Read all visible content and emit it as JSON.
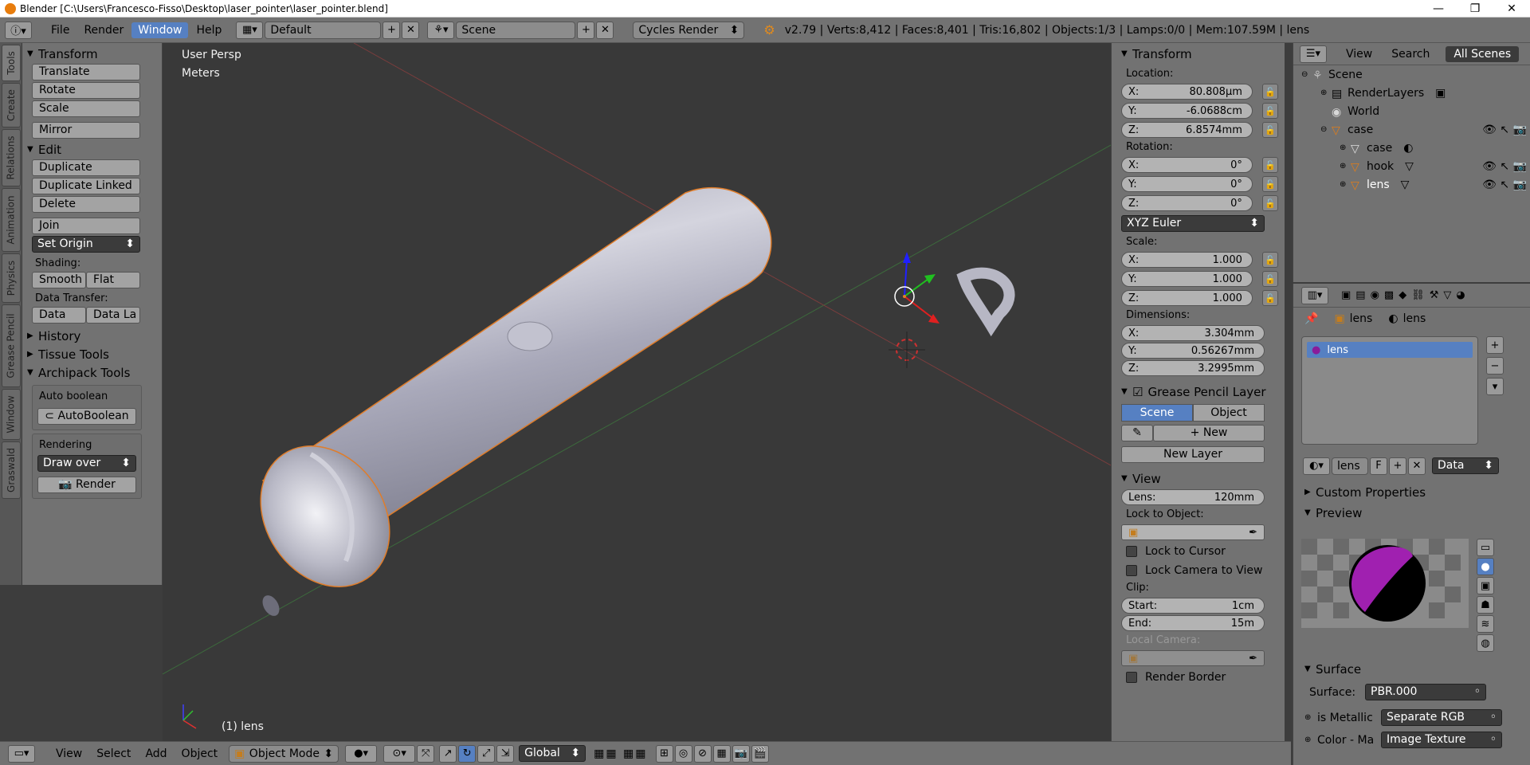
{
  "titlebar": {
    "title": "Blender [C:\\Users\\Francesco-Fisso\\Desktop\\laser_pointer\\laser_pointer.blend]",
    "minimize": "—",
    "maximize": "❐",
    "close": "✕"
  },
  "header": {
    "menus": [
      "File",
      "Render",
      "Window",
      "Help"
    ],
    "active_menu": "Window",
    "layout": "Default",
    "scene": "Scene",
    "engine": "Cycles Render",
    "stats": "v2.79 | Verts:8,412 | Faces:8,401 | Tris:16,802 | Objects:1/3 | Lamps:0/0 | Mem:107.59M | lens"
  },
  "vtabs": [
    "Tools",
    "Create",
    "Relations",
    "Animation",
    "Physics",
    "Grease Pencil",
    "Window",
    "Graswald"
  ],
  "toolshelf": {
    "transform": {
      "title": "Transform",
      "buttons": [
        "Translate",
        "Rotate",
        "Scale",
        "Mirror"
      ]
    },
    "edit": {
      "title": "Edit",
      "buttons": [
        "Duplicate",
        "Duplicate Linked",
        "Delete",
        "Join"
      ],
      "set_origin": "Set Origin",
      "shading_label": "Shading:",
      "smooth": "Smooth",
      "flat": "Flat",
      "data_transfer_label": "Data Transfer:",
      "data": "Data",
      "data_la": "Data La"
    },
    "history": "History",
    "tissue_tools": "Tissue Tools",
    "archipack": "Archipack Tools",
    "auto_boolean_label": "Auto boolean",
    "auto_boolean_btn": "AutoBoolean",
    "rendering_label": "Rendering",
    "draw_over": "Draw over",
    "render_btn": "Render"
  },
  "viewport": {
    "view_label": "User Persp",
    "units_label": "Meters",
    "object_label": "(1) lens"
  },
  "npanel": {
    "transform_title": "Transform",
    "location_label": "Location:",
    "location": {
      "x": "80.808µm",
      "y": "-6.0688cm",
      "z": "6.8574mm"
    },
    "rotation_label": "Rotation:",
    "rotation": {
      "x": "0°",
      "y": "0°",
      "z": "0°"
    },
    "rotation_mode": "XYZ Euler",
    "scale_label": "Scale:",
    "scale": {
      "x": "1.000",
      "y": "1.000",
      "z": "1.000"
    },
    "dimensions_label": "Dimensions:",
    "dimensions": {
      "x": "3.304mm",
      "y": "0.56267mm",
      "z": "3.2995mm"
    },
    "gp_title": "Grease Pencil Layer",
    "gp_scene": "Scene",
    "gp_object": "Object",
    "gp_new": "New",
    "gp_new_layer": "New Layer",
    "view_title": "View",
    "lens_label": "Lens:",
    "lens_value": "120mm",
    "lock_to_object": "Lock to Object:",
    "lock_to_cursor": "Lock to Cursor",
    "lock_camera": "Lock Camera to View",
    "clip_label": "Clip:",
    "clip_start_label": "Start:",
    "clip_start": "1cm",
    "clip_end_label": "End:",
    "clip_end": "15m",
    "local_camera": "Local Camera:",
    "render_border": "Render Border"
  },
  "outliner": {
    "view": "View",
    "search": "Search",
    "all_scenes": "All Scenes",
    "items": [
      "Scene",
      "RenderLayers",
      "World",
      "case",
      "case",
      "hook",
      "lens"
    ]
  },
  "properties": {
    "breadcrumb_obj": "lens",
    "breadcrumb_mat": "lens",
    "material_slot": "lens",
    "material_name": "lens",
    "f_label": "F",
    "link_mode": "Data",
    "custom_props": "Custom Properties",
    "preview": "Preview",
    "surface_title": "Surface",
    "surface_label": "Surface:",
    "surface_value": "PBR.000",
    "metallic_label": "is Metallic",
    "metallic_value": "Separate RGB",
    "color_label": "Color - Ma",
    "color_value": "Image Texture"
  },
  "statusbar": {
    "view": "View",
    "select": "Select",
    "add": "Add",
    "object": "Object",
    "mode": "Object Mode",
    "orientation": "Global"
  }
}
